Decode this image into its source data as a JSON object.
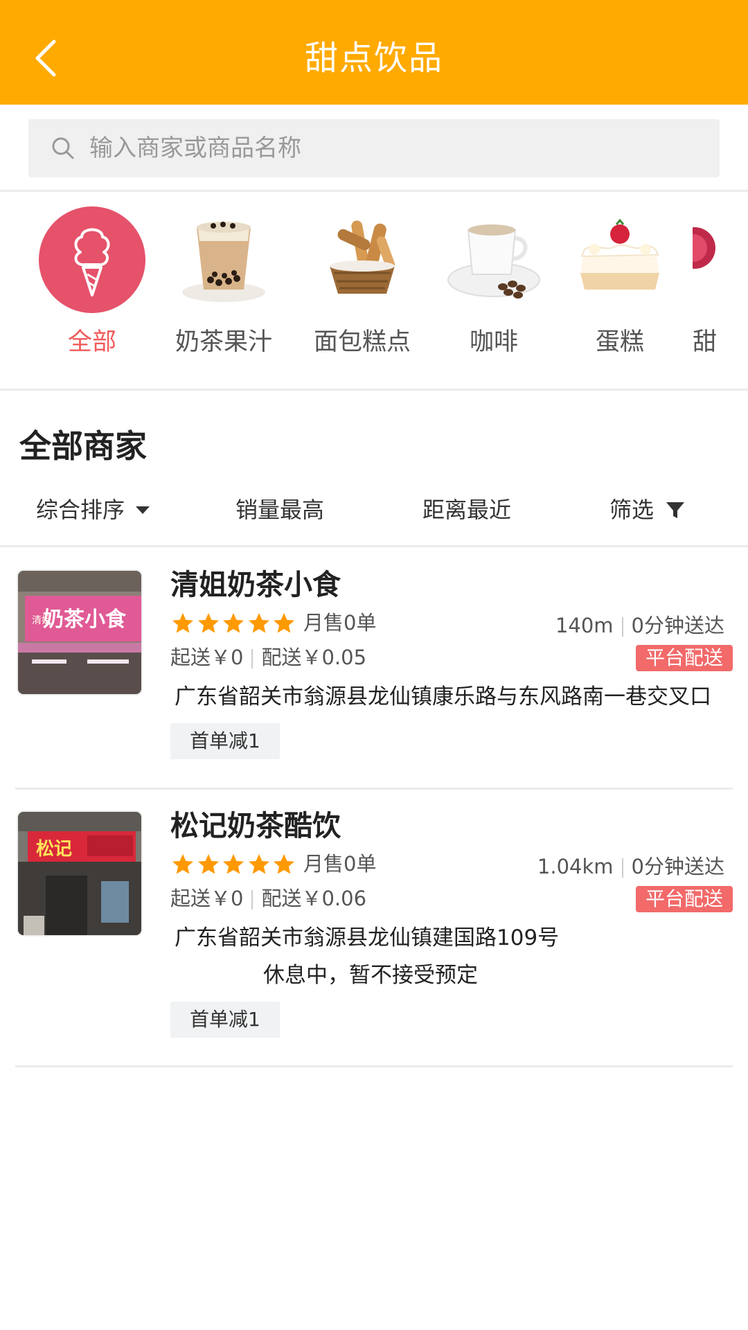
{
  "header": {
    "title": "甜点饮品",
    "back_icon": "chevron-left-icon"
  },
  "search": {
    "placeholder": "输入商家或商品名称",
    "icon": "search-icon"
  },
  "categories": [
    {
      "label": "全部",
      "icon": "ice-cream-icon",
      "active": true
    },
    {
      "label": "奶茶果汁",
      "icon": "bubble-tea-photo"
    },
    {
      "label": "面包糕点",
      "icon": "bread-basket-photo"
    },
    {
      "label": "咖啡",
      "icon": "coffee-cup-photo"
    },
    {
      "label": "蛋糕",
      "icon": "cake-photo"
    },
    {
      "label": "甜",
      "icon": "dessert-photo"
    }
  ],
  "section": {
    "title": "全部商家"
  },
  "sort": {
    "comprehensive": "综合排序",
    "sales": "销量最高",
    "distance": "距离最近",
    "filter": "筛选"
  },
  "shops": [
    {
      "name": "清姐奶茶小食",
      "rating": 5,
      "monthly_sales": "月售0单",
      "distance": "140m",
      "delivery_time": "0分钟送达",
      "min_order": "起送￥0",
      "delivery_fee": "配送￥0.05",
      "badge": "平台配送",
      "address": "广东省韶关市翁源县龙仙镇康乐路与东风路南一巷交叉口",
      "promo": "首单减1",
      "sign_text": "奶茶小食",
      "sign_small": "清姐"
    },
    {
      "name": "松记奶茶酷饮",
      "rating": 5,
      "monthly_sales": "月售0单",
      "distance": "1.04km",
      "delivery_time": "0分钟送达",
      "min_order": "起送￥0",
      "delivery_fee": "配送￥0.06",
      "badge": "平台配送",
      "address": "广东省韶关市翁源县龙仙镇建国路109号",
      "status": "休息中，暂不接受预定",
      "promo": "首单减1",
      "sign_text": "松记"
    }
  ],
  "colors": {
    "brand": "#FFAA00",
    "accent": "#F15A5A",
    "badge": "#F26A6A",
    "star": "#FF9900"
  }
}
